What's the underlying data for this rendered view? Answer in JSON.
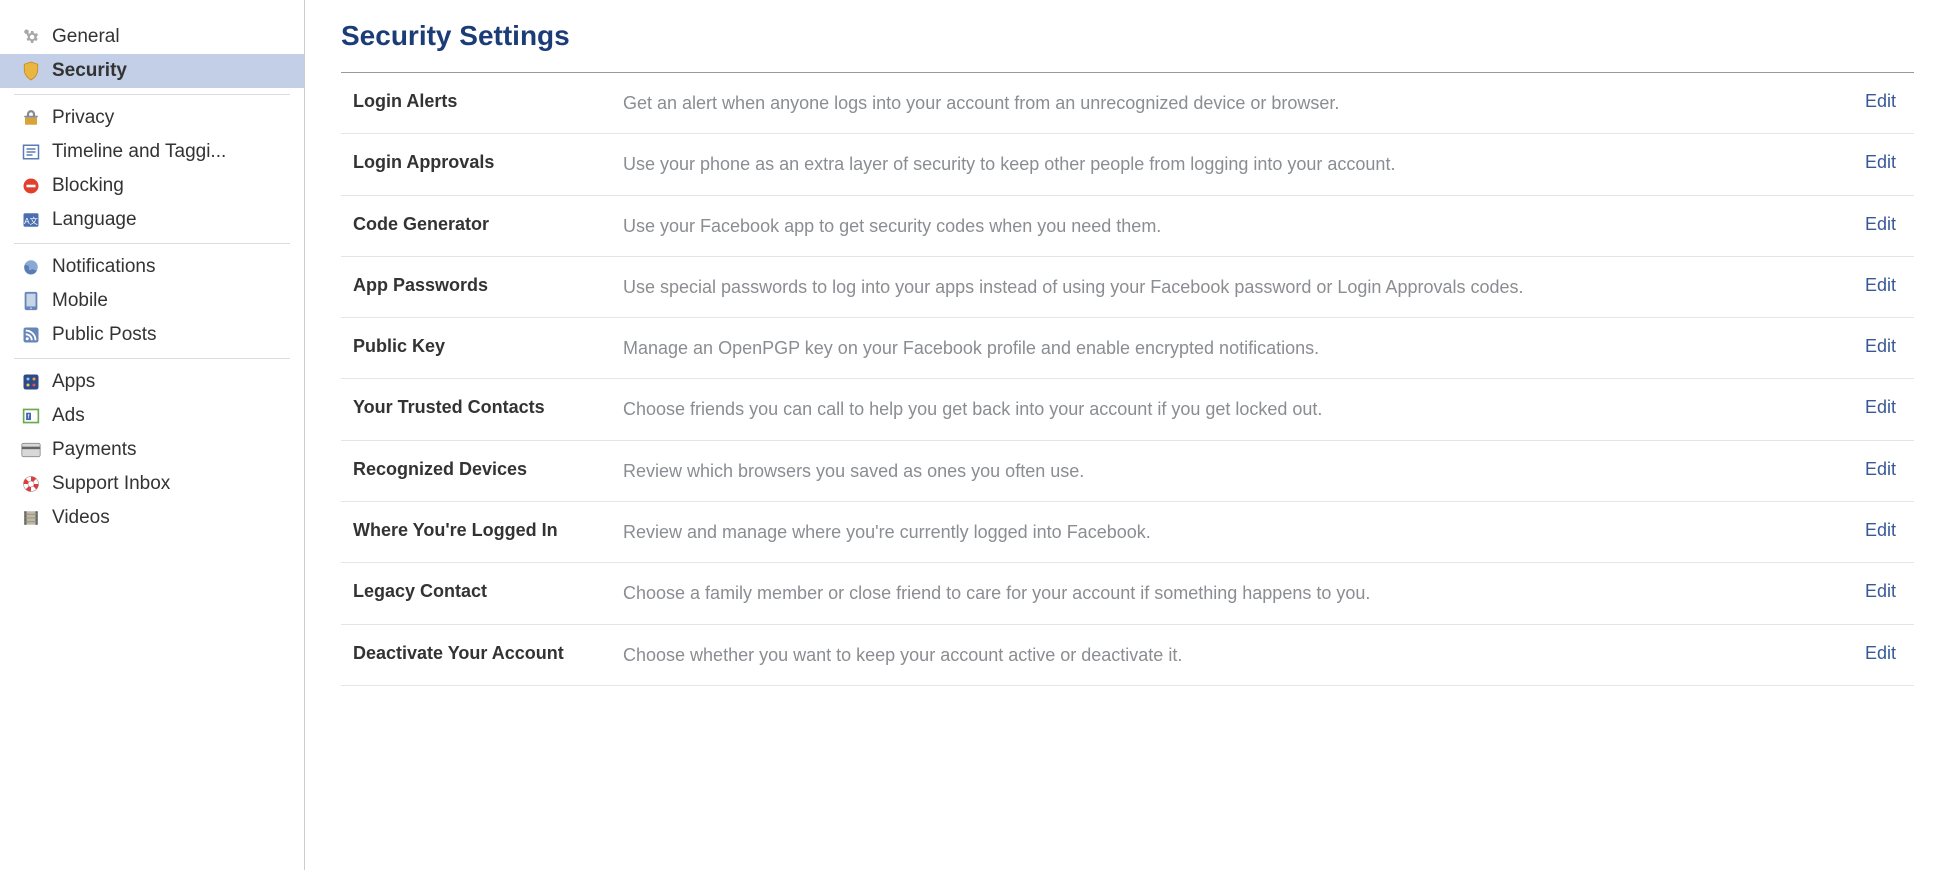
{
  "sidebar": {
    "groups": [
      {
        "items": [
          {
            "icon": "gear-icon",
            "label": "General",
            "selected": false
          },
          {
            "icon": "shield-icon",
            "label": "Security",
            "selected": true
          }
        ]
      },
      {
        "items": [
          {
            "icon": "lock-icon",
            "label": "Privacy",
            "selected": false
          },
          {
            "icon": "timeline-icon",
            "label": "Timeline and Taggi...",
            "selected": false
          },
          {
            "icon": "block-icon",
            "label": "Blocking",
            "selected": false
          },
          {
            "icon": "language-icon",
            "label": "Language",
            "selected": false
          }
        ]
      },
      {
        "items": [
          {
            "icon": "globe-icon",
            "label": "Notifications",
            "selected": false
          },
          {
            "icon": "mobile-icon",
            "label": "Mobile",
            "selected": false
          },
          {
            "icon": "rss-icon",
            "label": "Public Posts",
            "selected": false
          }
        ]
      },
      {
        "items": [
          {
            "icon": "apps-icon",
            "label": "Apps",
            "selected": false
          },
          {
            "icon": "ads-icon",
            "label": "Ads",
            "selected": false
          },
          {
            "icon": "card-icon",
            "label": "Payments",
            "selected": false
          },
          {
            "icon": "lifering-icon",
            "label": "Support Inbox",
            "selected": false
          },
          {
            "icon": "film-icon",
            "label": "Videos",
            "selected": false
          }
        ]
      }
    ]
  },
  "page_title": "Security Settings",
  "edit_label": "Edit",
  "settings": [
    {
      "label": "Login Alerts",
      "desc": "Get an alert when anyone logs into your account from an unrecognized device or browser."
    },
    {
      "label": "Login Approvals",
      "desc": "Use your phone as an extra layer of security to keep other people from logging into your account."
    },
    {
      "label": "Code Generator",
      "desc": "Use your Facebook app to get security codes when you need them."
    },
    {
      "label": "App Passwords",
      "desc": "Use special passwords to log into your apps instead of using your Facebook password or Login Approvals codes."
    },
    {
      "label": "Public Key",
      "desc": "Manage an OpenPGP key on your Facebook profile and enable encrypted notifications."
    },
    {
      "label": "Your Trusted Contacts",
      "desc": "Choose friends you can call to help you get back into your account if you get locked out."
    },
    {
      "label": "Recognized Devices",
      "desc": "Review which browsers you saved as ones you often use."
    },
    {
      "label": "Where You're Logged In",
      "desc": "Review and manage where you're currently logged into Facebook."
    },
    {
      "label": "Legacy Contact",
      "desc": "Choose a family member or close friend to care for your account if something happens to you."
    },
    {
      "label": "Deactivate Your Account",
      "desc": "Choose whether you want to keep your account active or deactivate it."
    }
  ]
}
